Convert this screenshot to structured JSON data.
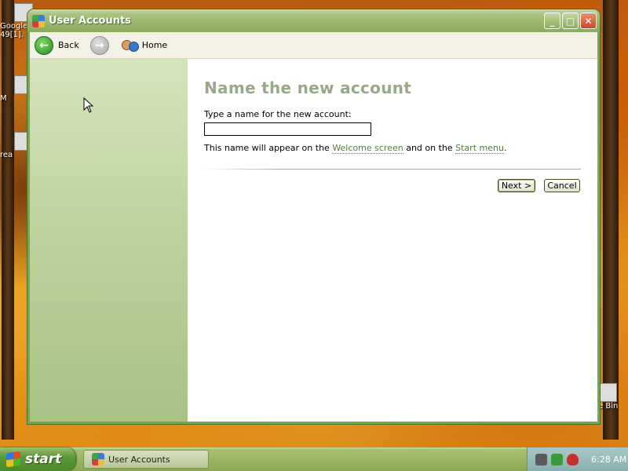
{
  "desktop": {
    "icons": [
      {
        "label": "Google 49[1].",
        "icon": "file-icon"
      },
      {
        "label": "M",
        "icon": "shortcut-icon"
      },
      {
        "label": "rea",
        "icon": "document-icon"
      },
      {
        "label": "e Bin",
        "icon": "recycle-bin-icon"
      }
    ]
  },
  "window": {
    "title": "User Accounts",
    "controls": {
      "minimize": "_",
      "maximize": "□",
      "close": "✕"
    }
  },
  "toolbar": {
    "back_label": "Back",
    "home_label": "Home"
  },
  "main": {
    "heading": "Name the new account",
    "prompt": "Type a name for the new account:",
    "name_value": "",
    "note_prefix": "This name will appear on the ",
    "welcome_link": "Welcome screen",
    "note_middle": " and on the ",
    "start_link": "Start menu",
    "note_suffix": ".",
    "next_label": "Next >",
    "cancel_label": "Cancel"
  },
  "taskbar": {
    "start_label": "start",
    "task_label": "User Accounts",
    "clock": "6:28 AM"
  },
  "colors": {
    "accent": "#7aa64e",
    "heading": "#9aa88a",
    "link": "#5a7a3a"
  }
}
